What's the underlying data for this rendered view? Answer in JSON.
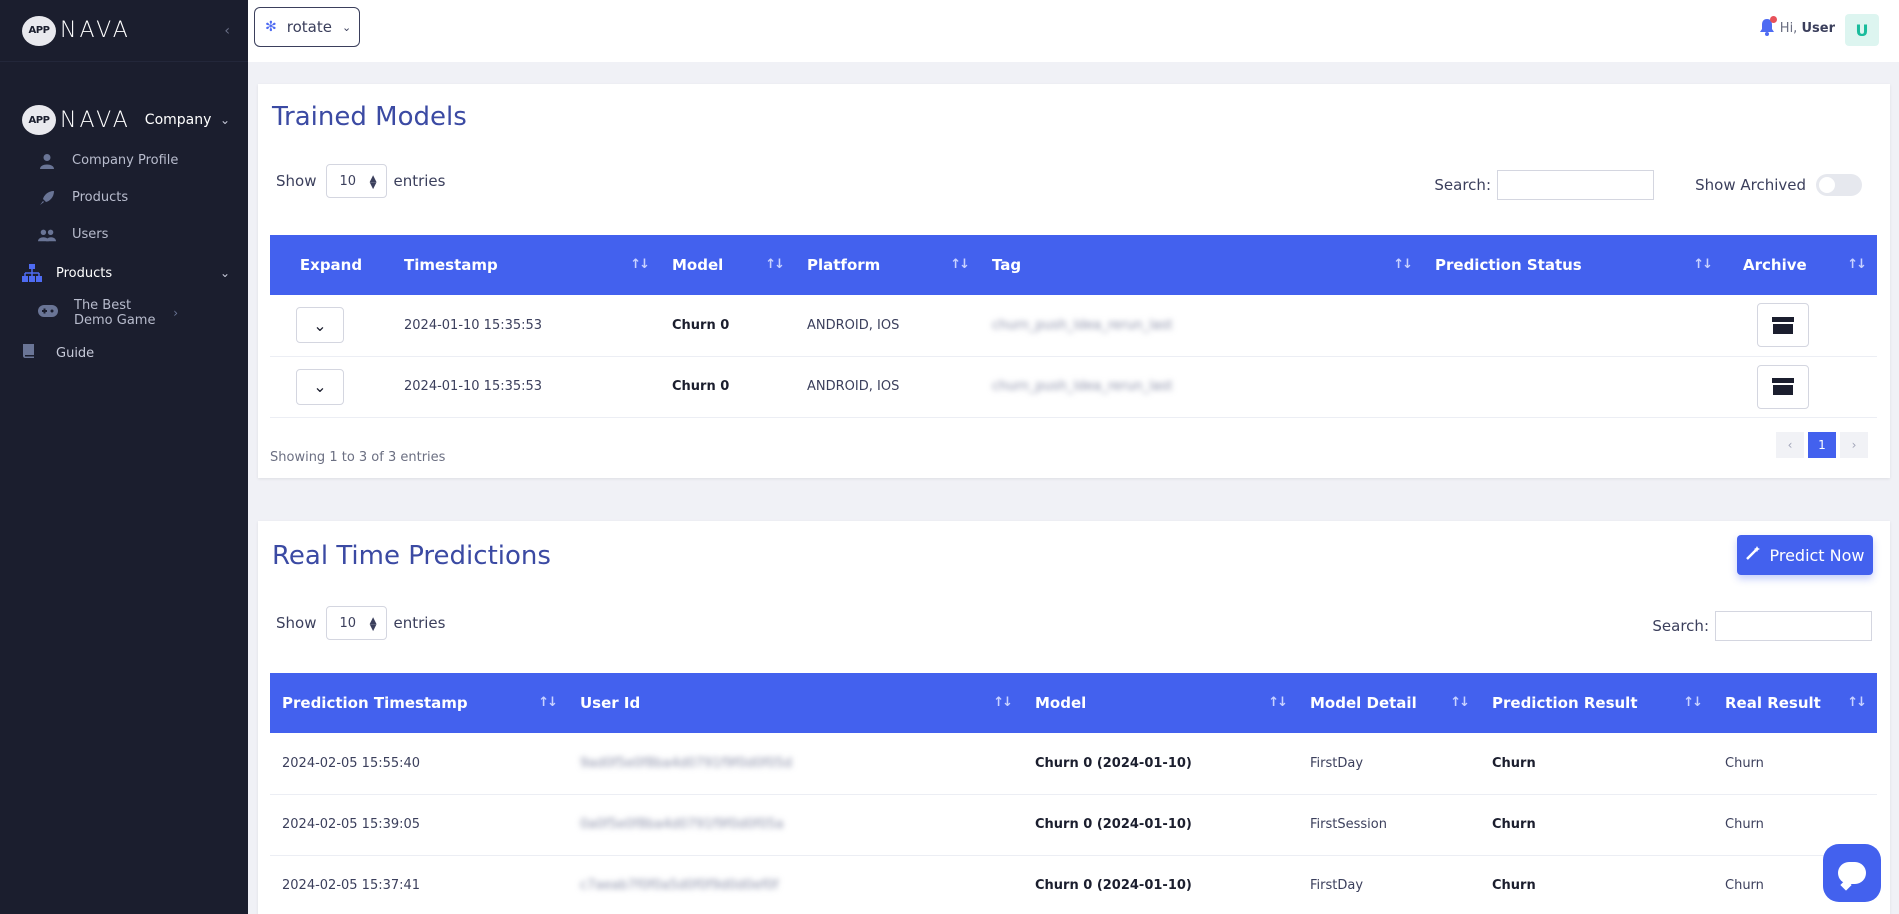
{
  "sidebar": {
    "logo_mark": "APP",
    "logo_text": "NAVA",
    "collapse_icon": "‹",
    "company_label": "Company",
    "company_items": [
      {
        "label": "Company Profile",
        "icon": "user-icon"
      },
      {
        "label": "Products",
        "icon": "rocket-icon"
      },
      {
        "label": "Users",
        "icon": "users-icon"
      }
    ],
    "products_label": "Products",
    "product_game": "The Best Demo Game",
    "guide_label": "Guide"
  },
  "topbar": {
    "project_name": "rotate",
    "greeting_prefix": "Hi,",
    "greeting_user": "User",
    "avatar_letter": "U"
  },
  "trained_models": {
    "title": "Trained Models",
    "show_label": "Show",
    "entries_value": "10",
    "entries_label": "entries",
    "search_label": "Search:",
    "show_archived_label": "Show Archived",
    "columns": [
      "Expand",
      "Timestamp",
      "Model",
      "Platform",
      "Tag",
      "Prediction Status",
      "Archive"
    ],
    "rows": [
      {
        "timestamp": "2024-01-10 15:35:53",
        "model": "Churn 0",
        "platform": "ANDROID, IOS",
        "tag": "churn_push_ldea_rerun_last"
      },
      {
        "timestamp": "2024-01-10 15:35:53",
        "model": "Churn 0",
        "platform": "ANDROID, IOS",
        "tag": "churn_push_ldea_rerun_last"
      }
    ],
    "info": "Showing 1 to 3 of 3 entries",
    "pager": {
      "prev": "‹",
      "page": "1",
      "next": "›"
    }
  },
  "realtime": {
    "title": "Real Time Predictions",
    "predict_label": "Predict Now",
    "show_label": "Show",
    "entries_value": "10",
    "entries_label": "entries",
    "search_label": "Search:",
    "columns": [
      "Prediction Timestamp",
      "User Id",
      "Model",
      "Model Detail",
      "Prediction Result",
      "Real Result"
    ],
    "rows": [
      {
        "ts": "2024-02-05 15:55:40",
        "user": "9ad0f5e0f8ba4d0791f9f0d0f05d",
        "model": "Churn 0 (2024-01-10)",
        "detail": "FirstDay",
        "pred": "Churn",
        "real": "Churn"
      },
      {
        "ts": "2024-02-05 15:39:05",
        "user": "0a0f5e0f8ba4d0791f9f0d0f05a",
        "model": "Churn 0 (2024-01-10)",
        "detail": "FirstSession",
        "pred": "Churn",
        "real": "Churn"
      },
      {
        "ts": "2024-02-05 15:37:41",
        "user": "c7aeab7f0f0a5d0f0f9d0d0ef0f",
        "model": "Churn 0 (2024-01-10)",
        "detail": "FirstDay",
        "pred": "Churn",
        "real": "Churn"
      }
    ]
  },
  "colors": {
    "accent": "#4361ee",
    "sidebar": "#1b1e2e",
    "title": "#3b4aa3"
  }
}
